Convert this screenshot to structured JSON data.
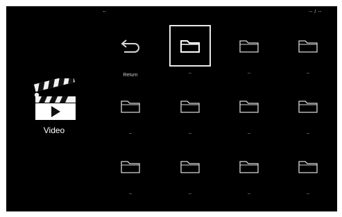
{
  "header": {
    "left_text": "--",
    "right_text": "-- / --"
  },
  "category": {
    "label": "Video",
    "icon": "clapperboard-icon"
  },
  "grid": {
    "items": [
      {
        "label": "Return",
        "icon": "return-icon",
        "selected": false
      },
      {
        "label": "--",
        "icon": "folder-icon",
        "selected": true
      },
      {
        "label": "--",
        "icon": "folder-icon",
        "selected": false
      },
      {
        "label": "--",
        "icon": "folder-icon",
        "selected": false
      },
      {
        "label": "--",
        "icon": "folder-icon",
        "selected": false
      },
      {
        "label": "--",
        "icon": "folder-icon",
        "selected": false
      },
      {
        "label": "--",
        "icon": "folder-icon",
        "selected": false
      },
      {
        "label": "--",
        "icon": "folder-icon",
        "selected": false
      },
      {
        "label": "--",
        "icon": "folder-icon",
        "selected": false
      },
      {
        "label": "--",
        "icon": "folder-icon",
        "selected": false
      },
      {
        "label": "--",
        "icon": "folder-icon",
        "selected": false
      },
      {
        "label": "--",
        "icon": "folder-icon",
        "selected": false
      }
    ]
  },
  "colors": {
    "background": "#000000",
    "frame": "#ffffff",
    "selection": "#e8e8e8",
    "icon": "#d8d8d8"
  }
}
